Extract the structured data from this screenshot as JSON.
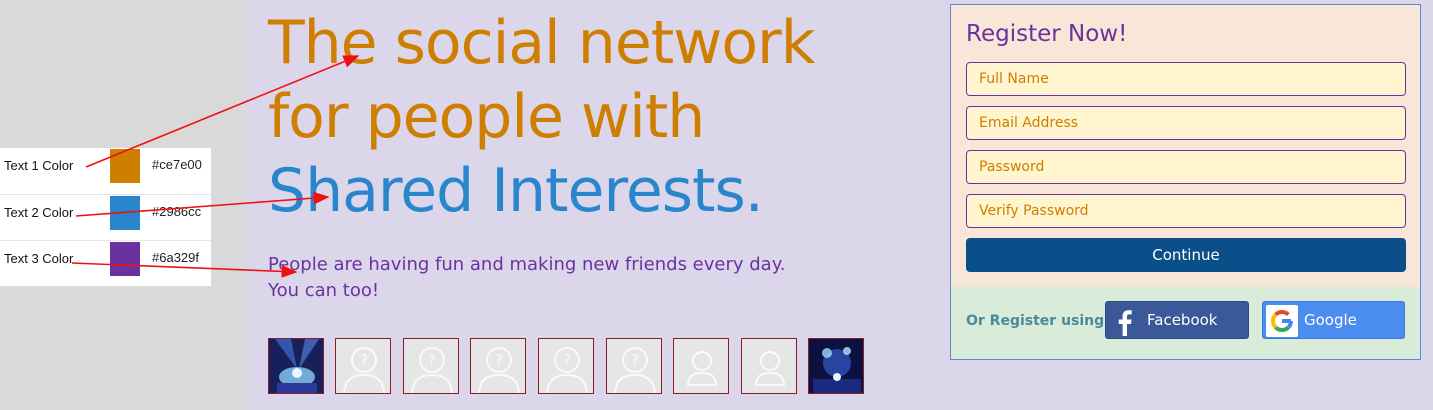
{
  "legend": {
    "rows": [
      {
        "label": "Text 1 Color",
        "hex": "#ce7e00"
      },
      {
        "label": "Text 2 Color",
        "hex": "#2986cc"
      },
      {
        "label": "Text 3 Color",
        "hex": "#6a329f"
      }
    ]
  },
  "hero": {
    "line1": "The social network",
    "line2": "for people with",
    "line3": "Shared Interests.",
    "tagline_line1": "People are having fun and making new friends every day.",
    "tagline_line2": "You can too!"
  },
  "friends": {
    "thumbnails": [
      "concert-photo",
      "question-avatar",
      "question-avatar",
      "question-avatar",
      "question-avatar",
      "question-avatar",
      "person-silhouette",
      "person-silhouette",
      "concert-photo"
    ]
  },
  "register": {
    "title": "Register Now!",
    "fields": {
      "full_name": "Full Name",
      "email": "Email Address",
      "password": "Password",
      "verify_password": "Verify Password"
    },
    "continue_label": "Continue",
    "or_register_label": "Or Register using",
    "facebook_label": "Facebook",
    "google_label": "Google"
  },
  "colors": {
    "text1": "#ce7e00",
    "text2": "#2986cc",
    "text3": "#6a329f",
    "annotation_arrow": "#ee1111",
    "continue_bg": "#0b4f8a",
    "facebook_bg": "#3b5998",
    "google_bg": "#4a8cf0",
    "or_register": "#4a8a9a"
  },
  "icons": [
    "facebook-icon",
    "google-icon",
    "question-avatar-icon",
    "person-silhouette-icon"
  ]
}
